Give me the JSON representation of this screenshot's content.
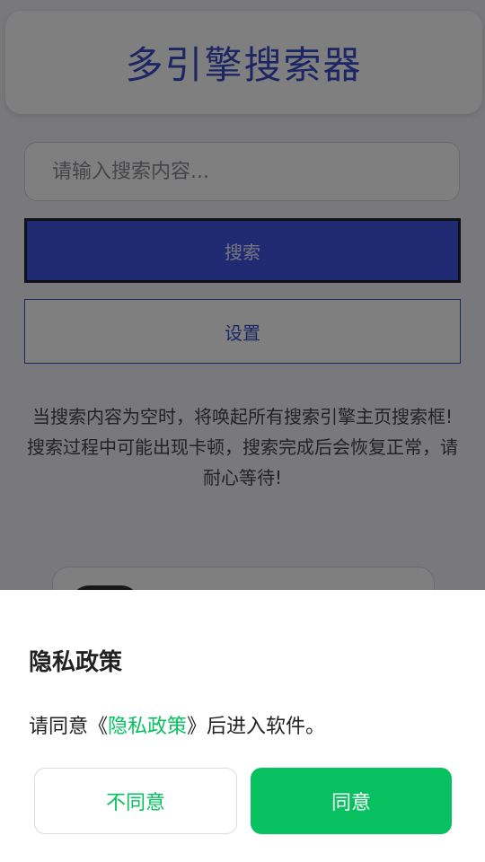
{
  "app": {
    "title": "多引擎搜索器"
  },
  "search": {
    "placeholder": "请输入搜索内容...",
    "value": "",
    "button_label": "搜索"
  },
  "settings": {
    "button_label": "设置"
  },
  "notice": {
    "line1": "当搜索内容为空时，将唤起所有搜索引擎主页搜索框!",
    "line2": "搜索过程中可能出现卡顿，搜索完成后会恢复正常，请耐心等待!"
  },
  "privacy_dialog": {
    "title": "隐私政策",
    "message_prefix": "请同意《",
    "message_link": "隐私政策",
    "message_suffix": "》后进入软件。",
    "disagree_label": "不同意",
    "agree_label": "同意"
  },
  "colors": {
    "accent": "#3b4cc8",
    "search_button": "#3f55e6",
    "agree_green": "#07c160",
    "overlay": "rgba(0,0,0,0.5)"
  }
}
